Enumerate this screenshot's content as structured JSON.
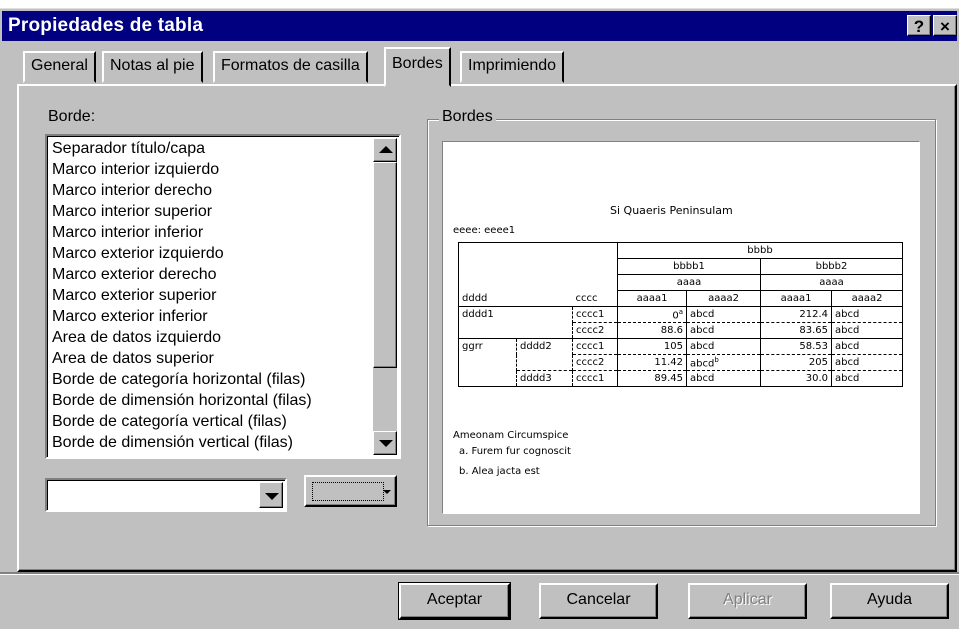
{
  "window": {
    "title": "Propiedades de tabla",
    "help_label": "?",
    "close_label": "×"
  },
  "tabs": [
    {
      "label": "General"
    },
    {
      "label": "Notas al pie"
    },
    {
      "label": "Formatos de casilla"
    },
    {
      "label": "Bordes",
      "active": true
    },
    {
      "label": "Imprimiendo"
    }
  ],
  "border_list": {
    "label": "Borde:",
    "items": [
      "Separador título/capa",
      "Marco interior izquierdo",
      "Marco interior derecho",
      "Marco interior superior",
      "Marco interior inferior",
      "Marco exterior izquierdo",
      "Marco exterior derecho",
      "Marco exterior superior",
      "Marco exterior inferior",
      "Area de datos izquierdo",
      "Area de datos superior",
      "Borde de categoría horizontal (filas)",
      "Borde de dimensión horizontal (filas)",
      "Borde de categoría vertical (filas)",
      "Borde de dimensión vertical (filas)"
    ]
  },
  "style_select": {
    "value": ""
  },
  "color_select": {
    "value": ""
  },
  "preview": {
    "group_label": "Bordes",
    "title": "Si Quaeris Peninsulam",
    "layer": "eeee: eeee1",
    "col_top": "bbbb",
    "col_sub1": "bbbb1",
    "col_sub2": "bbbb2",
    "col_aaaa": "aaaa",
    "row_header_1": "dddd",
    "row_header_2": "cccc",
    "leaf_headers": [
      "aaaa1",
      "aaaa2",
      "aaaa1",
      "aaaa2"
    ],
    "rows": [
      {
        "g": "",
        "d": "dddd1",
        "c": "cccc1",
        "v1": "0",
        "v1_sup": "a",
        "v2": "abcd",
        "v2_sup": "",
        "v3": "212.4",
        "v4": "abcd"
      },
      {
        "g": "",
        "d": "",
        "c": "cccc2",
        "v1": "88.6",
        "v1_sup": "",
        "v2": "abcd",
        "v2_sup": "",
        "v3": "83.65",
        "v4": "abcd"
      },
      {
        "g": "ggrr",
        "d": "dddd2",
        "c": "cccc1",
        "v1": "105",
        "v1_sup": "",
        "v2": "abcd",
        "v2_sup": "",
        "v3": "58.53",
        "v4": "abcd"
      },
      {
        "g": "",
        "d": "",
        "c": "cccc2",
        "v1": "11.42",
        "v1_sup": "",
        "v2": "abcd",
        "v2_sup": "b",
        "v3": "205",
        "v4": "abcd"
      },
      {
        "g": "",
        "d": "dddd3",
        "c": "cccc1",
        "v1": "89.45",
        "v1_sup": "",
        "v2": "abcd",
        "v2_sup": "",
        "v3": "30.0",
        "v4": "abcd"
      }
    ],
    "caption": "Ameonam Circumspice",
    "footnotes": [
      "a. Furem fur cognoscit",
      "b. Alea jacta est"
    ]
  },
  "buttons": {
    "ok": "Aceptar",
    "cancel": "Cancelar",
    "apply": "Aplicar",
    "help": "Ayuda"
  },
  "colors": {
    "titlebar": "#000080",
    "face": "#c0c0c0"
  }
}
